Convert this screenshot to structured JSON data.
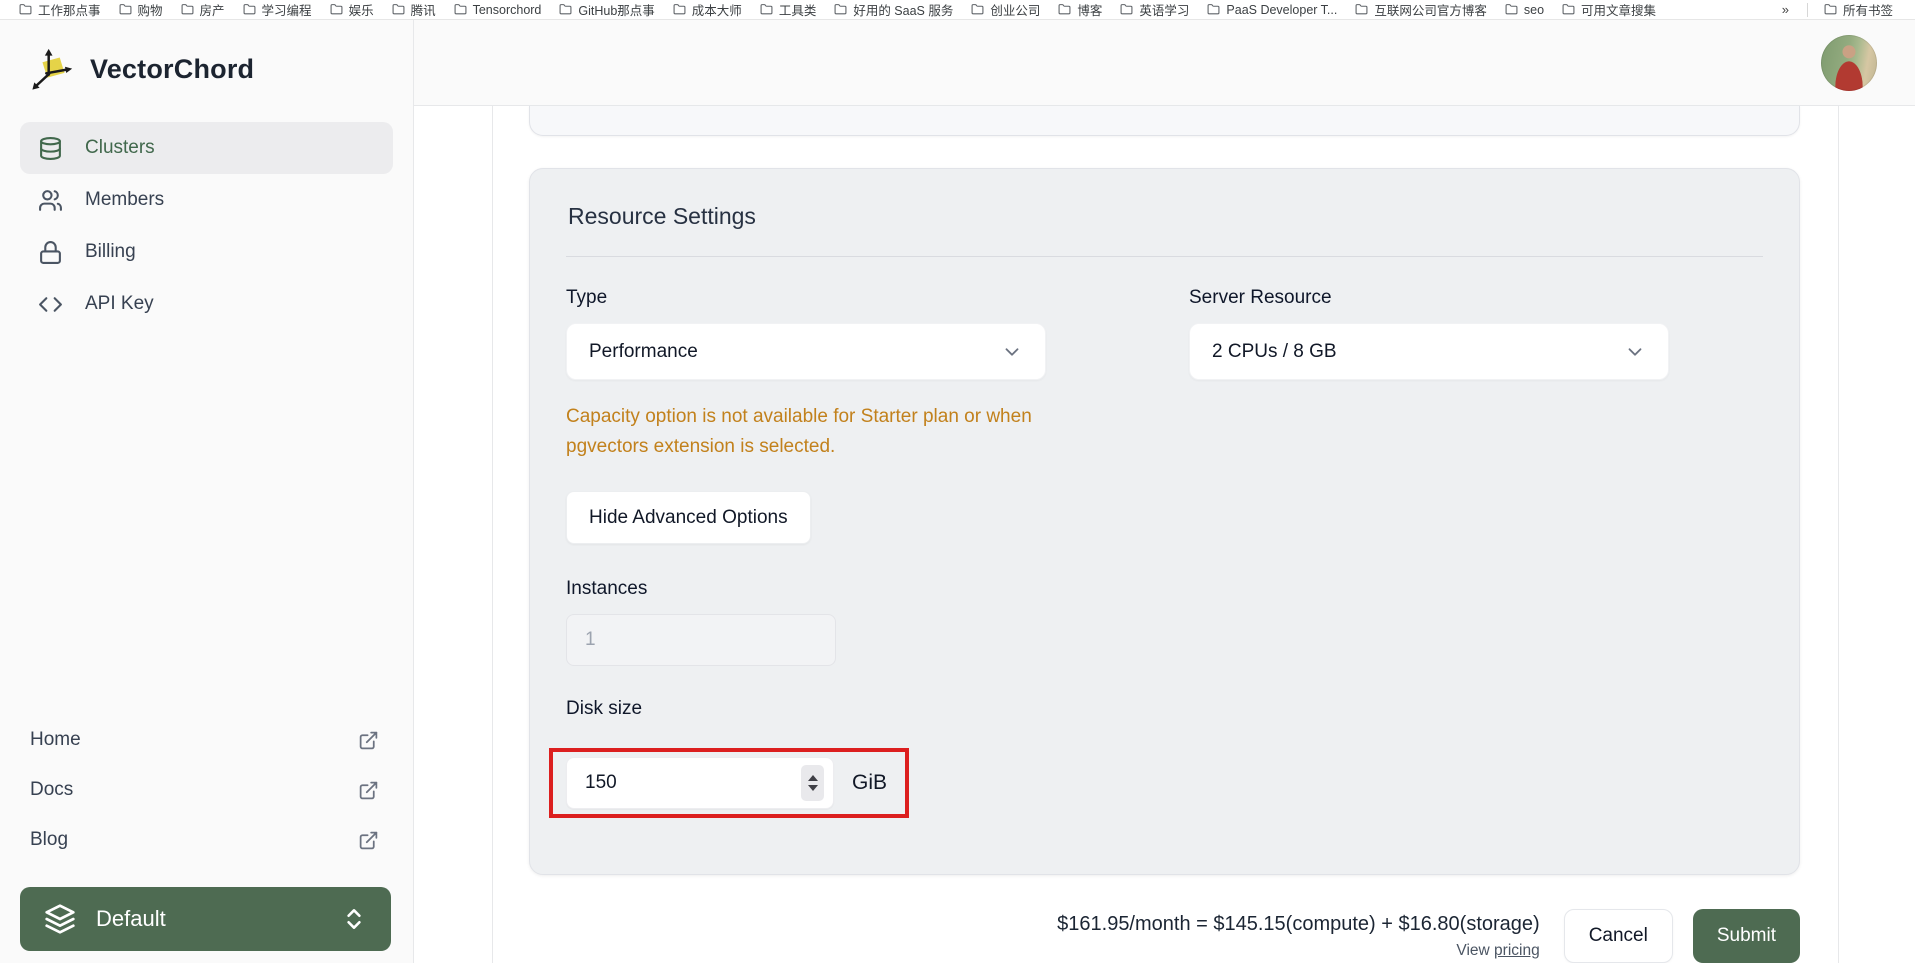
{
  "bookmarks_bar": {
    "items": [
      "工作那点事",
      "购物",
      "房产",
      "学习编程",
      "娱乐",
      "腾讯",
      "Tensorchord",
      "GitHub那点事",
      "成本大师",
      "工具类",
      "好用的 SaaS 服务",
      "创业公司",
      "博客",
      "英语学习",
      "PaaS Developer T...",
      "互联网公司官方博客",
      "seo",
      "可用文章搜集"
    ],
    "overflow_chevron": "»",
    "all_bookmarks_label": "所有书签"
  },
  "sidebar": {
    "logo_text": "VectorChord",
    "nav": [
      {
        "label": "Clusters",
        "active": true
      },
      {
        "label": "Members",
        "active": false
      },
      {
        "label": "Billing",
        "active": false
      },
      {
        "label": "API Key",
        "active": false
      }
    ],
    "footer_links": [
      "Home",
      "Docs",
      "Blog"
    ],
    "workspace_switcher": {
      "label": "Default"
    }
  },
  "card": {
    "title": "Resource Settings",
    "type_field": {
      "label": "Type",
      "value": "Performance"
    },
    "server_resource_field": {
      "label": "Server Resource",
      "value": "2 CPUs / 8 GB"
    },
    "warning": "Capacity option is not available for Starter plan or when pgvectors extension is selected.",
    "advanced_toggle_label": "Hide Advanced Options",
    "instances_field": {
      "label": "Instances",
      "value": "1"
    },
    "disk_size_field": {
      "label": "Disk size",
      "value": "150",
      "unit": "GiB"
    }
  },
  "footer_actions": {
    "price_summary": "$161.95/month = $145.15(compute) + $16.80(storage)",
    "view_pricing_prefix": "View ",
    "view_pricing_link": "pricing",
    "cancel_label": "Cancel",
    "submit_label": "Submit"
  },
  "colors": {
    "accent_green": "#41684c",
    "button_green": "#4e6b52",
    "warning_orange": "#c2811c",
    "highlight_red": "#dc1f1f",
    "logo_yellow": "#e5d348"
  }
}
